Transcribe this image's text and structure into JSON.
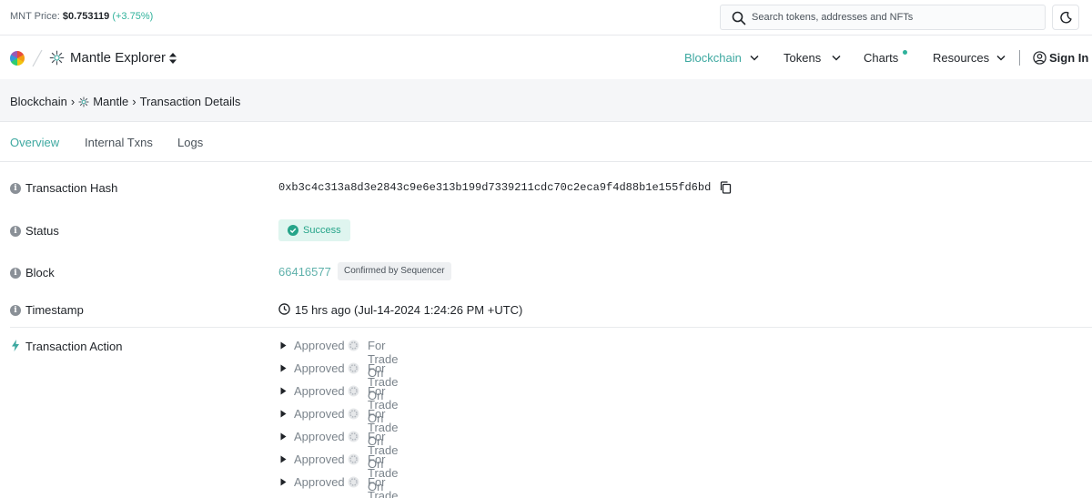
{
  "topbar": {
    "price_label": "MNT Price:",
    "price_value": "$0.753119",
    "price_change": "(+3.75%)",
    "search_placeholder": "Search tokens, addresses and NFTs",
    "search_icon": "search-icon",
    "theme_icon": "moon-icon"
  },
  "nav": {
    "brand": "Mantle Explorer",
    "items": [
      {
        "label": "Blockchain"
      },
      {
        "label": "Tokens"
      },
      {
        "label": "Charts"
      },
      {
        "label": "Resources"
      }
    ],
    "signin": "Sign In"
  },
  "breadcrumb": {
    "root": "Blockchain",
    "sep": "›",
    "chain": "Mantle",
    "current": "Transaction Details"
  },
  "tabs": [
    "Overview",
    "Internal Txns",
    "Logs"
  ],
  "details": {
    "hash_label": "Transaction Hash",
    "hash": "0xb3c4c313a8d3e2843c9e6e313b199d7339211cdc70c2eca9f4d88b1e155fd6bd",
    "status_label": "Status",
    "status": "Success",
    "block_label": "Block",
    "block": "66416577",
    "block_badge": "Confirmed by Sequencer",
    "timestamp_label": "Timestamp",
    "timestamp": "15 hrs ago (Jul-14-2024 1:24:26 PM +UTC)",
    "action_label": "Transaction Action",
    "actions": [
      {
        "verb": "Approved",
        "for": "For Trade On"
      },
      {
        "verb": "Approved",
        "for": "For Trade On"
      },
      {
        "verb": "Approved",
        "for": "For Trade On"
      },
      {
        "verb": "Approved",
        "for": "For Trade On"
      },
      {
        "verb": "Approved",
        "for": "For Trade On"
      },
      {
        "verb": "Approved",
        "for": "For Trade On"
      },
      {
        "verb": "Approved",
        "for": "For Trade On"
      }
    ]
  },
  "colors": {
    "accent": "#3da8a0",
    "success_bg": "#dff5ef",
    "success_text": "#26a489"
  }
}
